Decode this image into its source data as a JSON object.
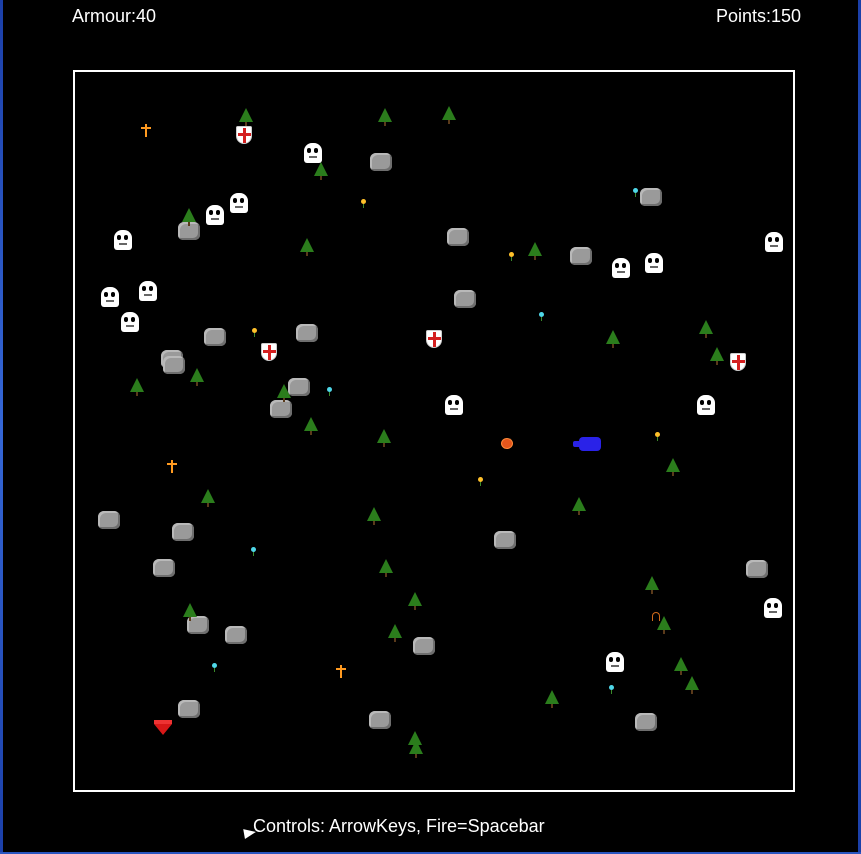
{
  "hud": {
    "armour": "Armour:40",
    "points": "Points:150",
    "controls": "Controls: ArrowKeys, Fire=Spacebar"
  },
  "colors": {
    "background": "#000000",
    "arena_border": "#ffffff",
    "player": "#2a22e8",
    "tree": "#2b7d1c",
    "rock": "#9a9a9a",
    "fireball": "#e4561c"
  },
  "sprite_types": [
    "rock",
    "tree",
    "ghost-enemy",
    "shield-pickup",
    "cross-pickup",
    "yellow-flower",
    "cyan-flower",
    "fireball",
    "player-ship",
    "gem-pickup",
    "hook-item"
  ]
}
